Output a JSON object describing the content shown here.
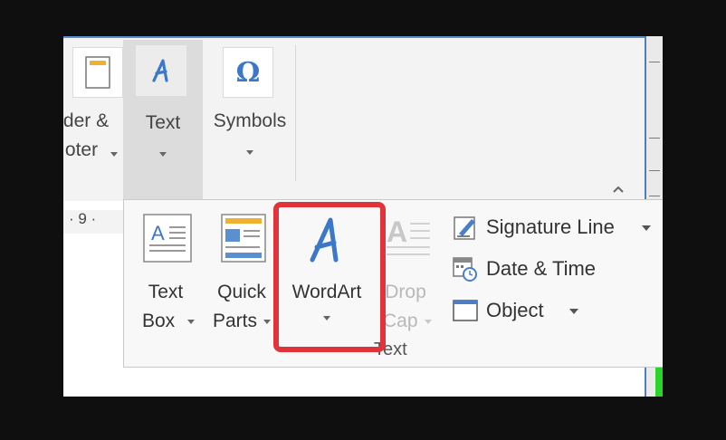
{
  "ribbon": {
    "header_footer": {
      "line1": "der &",
      "line2": "oter"
    },
    "text": {
      "label": "Text"
    },
    "symbols": {
      "label": "Symbols"
    }
  },
  "ruler": {
    "marks": "· 9 ·"
  },
  "text_dropdown": {
    "buttons": [
      {
        "line1": "Text",
        "line2": "Box",
        "icon": "text-box-icon"
      },
      {
        "line1": "Quick",
        "line2": "Parts",
        "icon": "quick-parts-icon"
      },
      {
        "line1": "WordArt",
        "line2": "",
        "icon": "wordart-icon"
      },
      {
        "line1": "Drop",
        "line2": "Cap",
        "icon": "drop-cap-icon",
        "disabled": true
      }
    ],
    "list": [
      {
        "label": "Signature Line",
        "icon": "signature-line-icon"
      },
      {
        "label": "Date & Time",
        "icon": "date-time-icon"
      },
      {
        "label": "Object",
        "icon": "object-icon"
      }
    ],
    "group_caption": "Text"
  },
  "colors": {
    "highlight": "#e0343a",
    "accent": "#4a7fc7",
    "selected_bg": "#dcdcdc"
  }
}
